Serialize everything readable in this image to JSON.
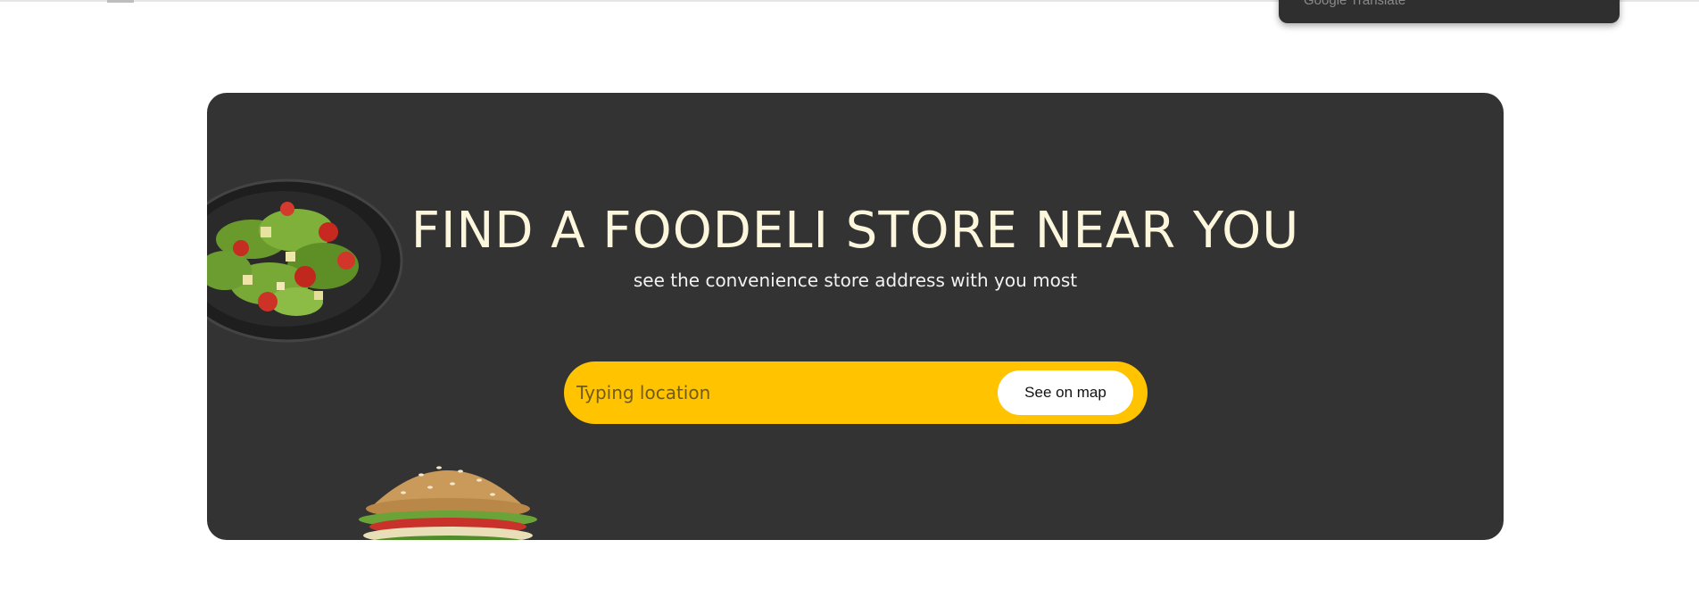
{
  "header": {
    "translate_widget_text": "Google Translate"
  },
  "store_finder": {
    "title": "FIND A FOODELI STORE NEAR YOU",
    "subtitle": "see the convenience store address with you most",
    "search": {
      "placeholder": "Typing location",
      "value": ""
    },
    "see_on_map_label": "See on map"
  },
  "colors": {
    "card_background": "#333333",
    "title_color": "#fbf6dc",
    "search_pill": "#ffc300",
    "button_background": "#ffffff"
  }
}
